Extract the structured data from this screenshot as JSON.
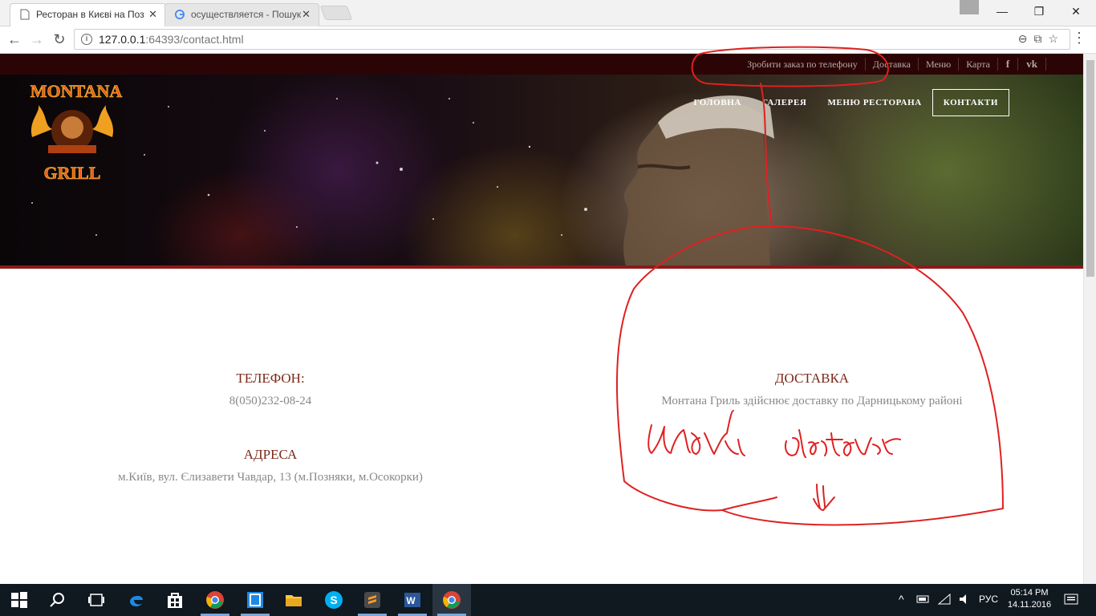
{
  "browser": {
    "tabs": [
      {
        "label": "Ресторан в Києві на Поз",
        "active": true,
        "icon": "page-icon"
      },
      {
        "label": "осуществляется - Пошук",
        "active": false,
        "icon": "google-icon"
      }
    ],
    "address": {
      "host": "127.0.0.1",
      "rest": ":64393/contact.html"
    },
    "window_buttons": {
      "minimize": "—",
      "restore": "❐",
      "close": "✕"
    }
  },
  "site": {
    "top_links": [
      "Зробити заказ по телефону",
      "Доставка",
      "Меню",
      "Карта"
    ],
    "social": [
      "f",
      "vk"
    ],
    "logo_alt": "Montana Grill",
    "nav": [
      "ГОЛОВНА",
      "ГАЛЕРЕЯ",
      "МЕНЮ РЕСТОРАНА",
      "КОНТАКТИ"
    ],
    "active_nav": "КОНТАКТИ"
  },
  "contact": {
    "phone_title": "ТЕЛЕФОН:",
    "phone_value": "8(050)232-08-24",
    "address_title": "АДРЕСА",
    "address_value": "м.Київ, вул. Єлизавети Чавдар, 13 (м.Позняки, м.Осокорки)",
    "delivery_title": "ДОСТАВКА",
    "delivery_value": "Монтана Гриль здійснює доставку по Дарницькому районі"
  },
  "annotation": {
    "handwritten_text": "Умови доставки",
    "color": "#e02020"
  },
  "taskbar": {
    "lang": "РУС",
    "time": "05:14 PM",
    "date": "14.11.2016"
  },
  "colors": {
    "top_strip": "#2b0505",
    "accent": "#8b1a1a",
    "heading": "#7a2a1a",
    "text": "#888888"
  }
}
